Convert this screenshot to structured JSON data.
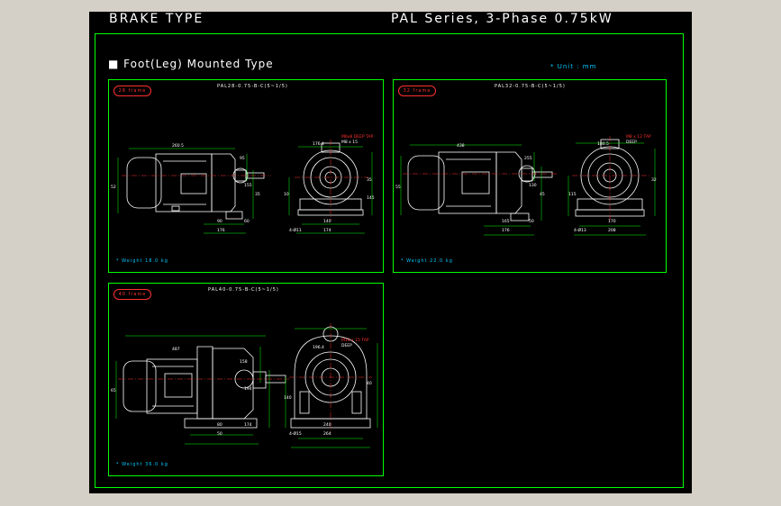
{
  "header": {
    "left_title": "BRAKE TYPE",
    "right_title": "PAL Series, 3-Phase 0.75kW"
  },
  "section_title": "Foot(Leg) Mounted Type",
  "unit_note": "* Unit : mm",
  "colors": {
    "border": "#00ff00",
    "line": "#ffffff",
    "centerline": "#ff3030",
    "dimension": "#00ff00",
    "annotation": "#ff3030",
    "note": "#00c8ff"
  },
  "panels": [
    {
      "frame": "28 frame",
      "model": "PAL28-0.75-B-C(5~1/5)",
      "weight": "* Weight 18.0 kg",
      "side_dims": [
        "260.5",
        "52",
        "95",
        "155",
        "90",
        "60",
        "176",
        "35"
      ],
      "front_dims": [
        "176.4",
        "M6x8 DEEP TAP",
        "M8 x 15",
        "140",
        "174",
        "4-Ø11",
        "10",
        "35",
        "145"
      ]
    },
    {
      "frame": "32 frame",
      "model": "PAL32-0.75-B-C(5~1/5)",
      "weight": "* Weight 22.0 kg",
      "side_dims": [
        "438",
        "55",
        "255",
        "130",
        "165",
        "50",
        "176",
        "45"
      ],
      "front_dims": [
        "180.5",
        "M8 x 12 TAP",
        "DEEP",
        "170",
        "208",
        "4-Ø13",
        "115",
        "32"
      ]
    },
    {
      "frame": "40 frame",
      "model": "PAL40-0.75-B-C(5~1/5)",
      "weight": "* Weight 36.0 kg",
      "side_dims": [
        "487",
        "65",
        "158",
        "194",
        "80",
        "174",
        "50"
      ],
      "front_dims": [
        "196.4",
        "M10 x 15 TAP",
        "DEEP",
        "240",
        "264",
        "4-Ø15",
        "140",
        "40"
      ]
    }
  ]
}
